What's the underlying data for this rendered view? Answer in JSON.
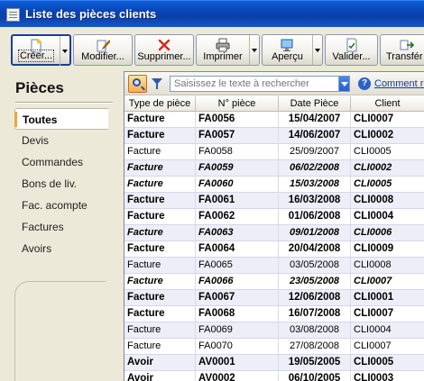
{
  "window": {
    "title": "Liste des pièces clients"
  },
  "toolbar": {
    "buttons": [
      {
        "label": "Créer...",
        "icon": "new-document-icon",
        "split": true
      },
      {
        "label": "Modifier...",
        "icon": "edit-document-icon",
        "split": false
      },
      {
        "label": "Supprimer...",
        "icon": "delete-x-icon",
        "split": false
      },
      {
        "label": "Imprimer",
        "icon": "printer-icon",
        "split": true
      },
      {
        "label": "Aperçu",
        "icon": "preview-icon",
        "split": true
      },
      {
        "label": "Valider...",
        "icon": "validate-icon",
        "split": false
      },
      {
        "label": "Transfér",
        "icon": "transfer-icon",
        "split": false
      }
    ]
  },
  "sidebar": {
    "title": "Pièces",
    "items": [
      {
        "label": "Toutes",
        "active": true
      },
      {
        "label": "Devis"
      },
      {
        "label": "Commandes"
      },
      {
        "label": "Bons de liv."
      },
      {
        "label": "Fac. acompte"
      },
      {
        "label": "Factures"
      },
      {
        "label": "Avoirs"
      }
    ]
  },
  "search": {
    "placeholder": "Saisissez le texte à rechercher",
    "help_link": "Comment re"
  },
  "table": {
    "columns": [
      "Type de pièce",
      "N° pièce",
      "Date Pièce",
      "Client"
    ],
    "rows": [
      {
        "type": "Facture",
        "num": "FA0056",
        "date": "15/04/2007",
        "client": "CLI0007",
        "style": "bold"
      },
      {
        "type": "Facture",
        "num": "FA0057",
        "date": "14/06/2007",
        "client": "CLI0002",
        "style": "bold"
      },
      {
        "type": "Facture",
        "num": "FA0058",
        "date": "25/09/2007",
        "client": "CLI0005",
        "style": "plain"
      },
      {
        "type": "Facture",
        "num": "FA0059",
        "date": "06/02/2008",
        "client": "CLI0002",
        "style": "ital"
      },
      {
        "type": "Facture",
        "num": "FA0060",
        "date": "15/03/2008",
        "client": "CLI0005",
        "style": "ital"
      },
      {
        "type": "Facture",
        "num": "FA0061",
        "date": "16/03/2008",
        "client": "CLI0008",
        "style": "bold"
      },
      {
        "type": "Facture",
        "num": "FA0062",
        "date": "01/06/2008",
        "client": "CLI0004",
        "style": "bold"
      },
      {
        "type": "Facture",
        "num": "FA0063",
        "date": "09/01/2008",
        "client": "CLI0006",
        "style": "ital"
      },
      {
        "type": "Facture",
        "num": "FA0064",
        "date": "20/04/2008",
        "client": "CLI0009",
        "style": "bold"
      },
      {
        "type": "Facture",
        "num": "FA0065",
        "date": "03/05/2008",
        "client": "CLI0008",
        "style": "plain"
      },
      {
        "type": "Facture",
        "num": "FA0066",
        "date": "23/05/2008",
        "client": "CLI0007",
        "style": "ital"
      },
      {
        "type": "Facture",
        "num": "FA0067",
        "date": "12/06/2008",
        "client": "CLI0001",
        "style": "bold"
      },
      {
        "type": "Facture",
        "num": "FA0068",
        "date": "16/07/2008",
        "client": "CLI0007",
        "style": "bold"
      },
      {
        "type": "Facture",
        "num": "FA0069",
        "date": "03/08/2008",
        "client": "CLI0004",
        "style": "plain"
      },
      {
        "type": "Facture",
        "num": "FA0070",
        "date": "27/08/2008",
        "client": "CLI0007",
        "style": "plain"
      },
      {
        "type": "Avoir",
        "num": "AV0001",
        "date": "19/05/2005",
        "client": "CLI0005",
        "style": "bold"
      },
      {
        "type": "Avoir",
        "num": "AV0002",
        "date": "06/10/2005",
        "client": "CLI0003",
        "style": "bold"
      }
    ]
  },
  "colors": {
    "titlebar": "#0842b0",
    "selected_accent": "#f2a33a",
    "alt_row": "#eeeef8"
  }
}
